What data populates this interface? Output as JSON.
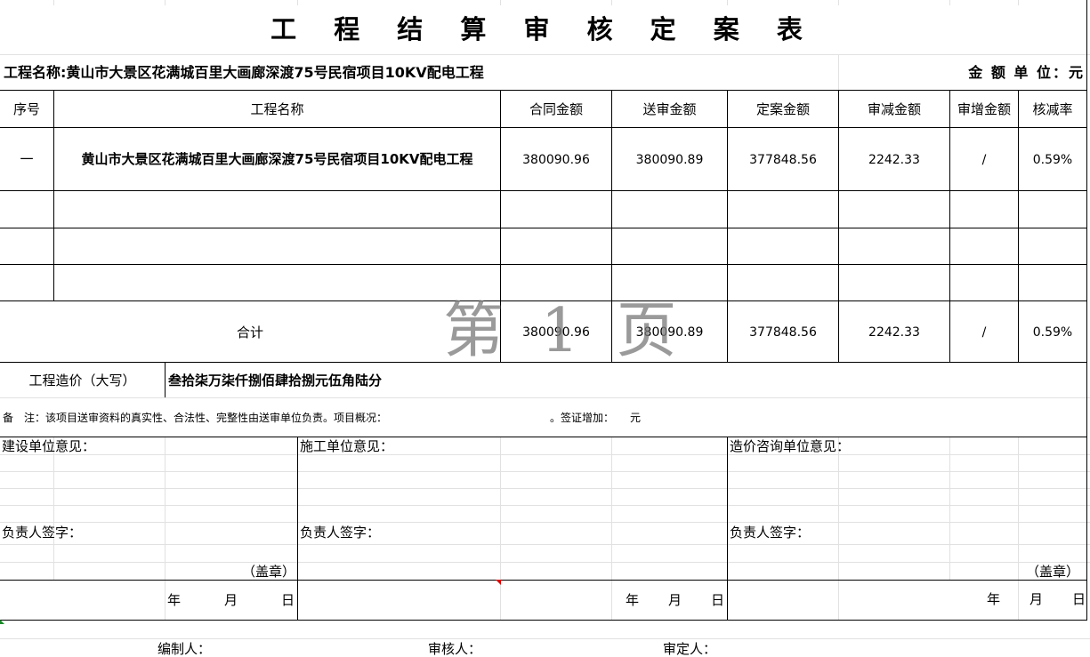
{
  "title": "工 程 结 算 审 核 定 案 表",
  "project_line": {
    "label": "工程名称:黄山市大景区花满城百里大画廊深渡75号民宿项目10KV配电工程",
    "unit": "金 额 单 位：元"
  },
  "table": {
    "headers": [
      "序号",
      "工程名称",
      "合同金额",
      "送审金额",
      "定案金额",
      "审减金额",
      "审增金额",
      "核减率"
    ],
    "rows": [
      [
        "一",
        "黄山市大景区花满城百里大画廊深渡75号民宿项目10KV配电工程",
        "380090.96",
        "380090.89",
        "377848.56",
        "2242.33",
        "/",
        "0.59%"
      ]
    ],
    "total": {
      "label": "合计",
      "values": [
        "380090.96",
        "380090.89",
        "377848.56",
        "2242.33",
        "/",
        "0.59%"
      ]
    }
  },
  "watermark": "第 1 页",
  "cost_capital": {
    "label": "工程造价（大写）",
    "value": "叁拾柒万柒仟捌佰肆拾捌元伍角陆分"
  },
  "remark": {
    "text": "备　注：该项目送审资料的真实性、合法性、完整性由送审单位负责。项目概况：",
    "tail": "。签证增加：　　元"
  },
  "opinions": [
    {
      "title": "建设单位意见：",
      "sign": "负责人签字：",
      "seal": "（盖章）",
      "year": "年",
      "month": "月",
      "day": "日"
    },
    {
      "title": "施工单位意见：",
      "sign": "负责人签字：",
      "seal": "（盖章）",
      "year": "年",
      "month": "月",
      "day": "日"
    },
    {
      "title": "造价咨询单位意见：",
      "sign": "负责人签字：",
      "seal": "（盖章）",
      "year": "年",
      "month": "月",
      "day": "日"
    }
  ],
  "footer": {
    "compiler": "编制人：",
    "reviewer": "审核人：",
    "approver": "审定人："
  }
}
